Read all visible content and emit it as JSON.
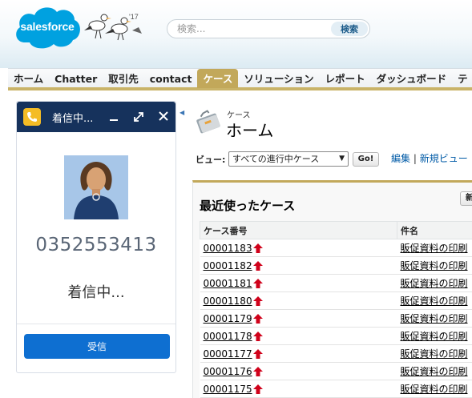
{
  "header": {
    "logo_text": "salesforce",
    "mascot_year": "'17",
    "search_placeholder": "検索...",
    "search_button": "検索"
  },
  "tabs": [
    {
      "label": "ホーム",
      "active": false
    },
    {
      "label": "Chatter",
      "active": false
    },
    {
      "label": "取引先",
      "active": false
    },
    {
      "label": "contact",
      "active": false
    },
    {
      "label": "ケース",
      "active": true
    },
    {
      "label": "ソリューション",
      "active": false
    },
    {
      "label": "レポート",
      "active": false
    },
    {
      "label": "ダッシュボード",
      "active": false
    },
    {
      "label": "テ",
      "active": false
    }
  ],
  "softphone": {
    "title": "着信中...",
    "number": "0352553413",
    "status": "着信中...",
    "accept_button": "受信",
    "icons": [
      "phone-icon",
      "minimize-icon",
      "expand-icon",
      "close-icon"
    ]
  },
  "page": {
    "subtitle": "ケース",
    "title": "ホーム",
    "view_label": "ビュー:",
    "view_selected": "すべての進行中ケース",
    "go_button": "Go!",
    "edit_link": "編集",
    "new_view_link": "新規ビュー",
    "link_separator": "|"
  },
  "recent": {
    "title": "最近使ったケース",
    "new_button": "新",
    "columns": [
      "ケース番号",
      "件名"
    ],
    "rows": [
      {
        "number": "00001183",
        "subject": "販促資料の印刷"
      },
      {
        "number": "00001182",
        "subject": "販促資料の印刷"
      },
      {
        "number": "00001181",
        "subject": "販促資料の印刷"
      },
      {
        "number": "00001180",
        "subject": "販促資料の印刷"
      },
      {
        "number": "00001179",
        "subject": "販促資料の印刷"
      },
      {
        "number": "00001178",
        "subject": "販促資料の印刷"
      },
      {
        "number": "00001177",
        "subject": "販促資料の印刷"
      },
      {
        "number": "00001176",
        "subject": "販促資料の印刷"
      },
      {
        "number": "00001175",
        "subject": "販促資料の印刷"
      }
    ]
  },
  "colors": {
    "header_navy": "#16325c",
    "accept_blue": "#0e6fd1",
    "tab_gold": "#c2a85a",
    "logo_blue": "#00a1e0",
    "escalation_red": "#d0021b"
  }
}
